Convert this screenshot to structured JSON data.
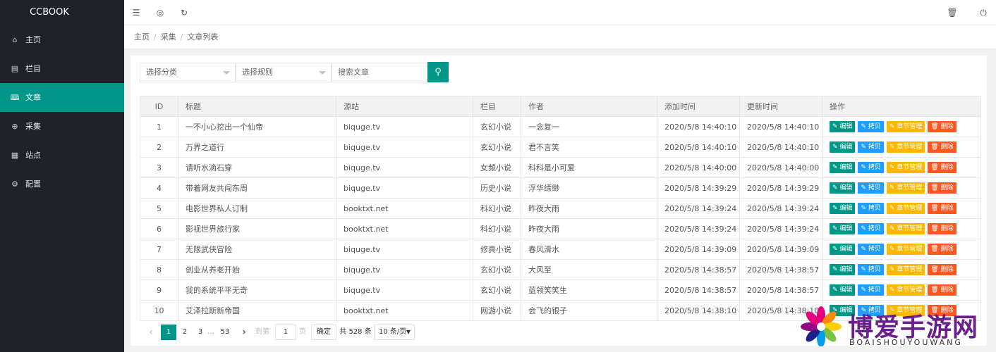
{
  "sidebar": {
    "logo": "CCBOOK",
    "items": [
      {
        "label": "主页",
        "icon": "⌂"
      },
      {
        "label": "栏目",
        "icon": "▤"
      },
      {
        "label": "文章",
        "icon": "🕮"
      },
      {
        "label": "采集",
        "icon": "⊕"
      },
      {
        "label": "站点",
        "icon": "▦"
      },
      {
        "label": "配置",
        "icon": "⚙"
      }
    ],
    "active_index": 2
  },
  "header": {
    "menu_icon": "☰",
    "globe_icon": "◎",
    "refresh_icon": "↻",
    "trash_icon": "🗑",
    "power_icon": "⏻"
  },
  "breadcrumb": [
    "主页",
    "采集",
    "文章列表"
  ],
  "filters": {
    "category_placeholder": "选择分类",
    "rule_placeholder": "选择规则",
    "search_placeholder": "搜索文章",
    "search_icon": "⚲"
  },
  "table": {
    "headers": [
      "ID",
      "标题",
      "源站",
      "栏目",
      "作者",
      "添加时间",
      "更新时间",
      "操作"
    ],
    "rows": [
      [
        "1",
        "一不小心挖出一个仙帝",
        "biquge.tv",
        "玄幻小说",
        "一念复一",
        "2020/5/8 14:40:10",
        "2020/5/8 14:40:10"
      ],
      [
        "2",
        "万界之道行",
        "biquge.tv",
        "玄幻小说",
        "君不言笑",
        "2020/5/8 14:40:10",
        "2020/5/8 14:40:10"
      ],
      [
        "3",
        "请听水滴石穿",
        "biquge.tv",
        "女频小说",
        "科科是小可爱",
        "2020/5/8 14:40:00",
        "2020/5/8 14:40:00"
      ],
      [
        "4",
        "带着网友共闯东周",
        "biquge.tv",
        "历史小说",
        "浮华缥缈",
        "2020/5/8 14:39:29",
        "2020/5/8 14:39:29"
      ],
      [
        "5",
        "电影世界私人订制",
        "booktxt.net",
        "科幻小说",
        "昨夜大雨",
        "2020/5/8 14:39:24",
        "2020/5/8 14:39:24"
      ],
      [
        "6",
        "影视世界旅行家",
        "booktxt.net",
        "科幻小说",
        "昨夜大雨",
        "2020/5/8 14:39:24",
        "2020/5/8 14:39:24"
      ],
      [
        "7",
        "无限武侠冒险",
        "biquge.tv",
        "修真小说",
        "春风滑水",
        "2020/5/8 14:39:09",
        "2020/5/8 14:39:09"
      ],
      [
        "8",
        "创业从养老开始",
        "biquge.tv",
        "玄幻小说",
        "大风至",
        "2020/5/8 14:38:57",
        "2020/5/8 14:38:57"
      ],
      [
        "9",
        "我的系统平平无奇",
        "biquge.tv",
        "玄幻小说",
        "蓝领笑笑生",
        "2020/5/8 14:38:57",
        "2020/5/8 14:38:57"
      ],
      [
        "10",
        "艾泽拉斯新帝国",
        "booktxt.net",
        "网游小说",
        "会飞的银子",
        "2020/5/8 14:38:10",
        "2020/5/8 14:38:10"
      ]
    ],
    "actions": {
      "edit": "编辑",
      "copy": "拷贝",
      "chapters": "章节管理",
      "delete": "删除"
    }
  },
  "pager": {
    "prev": "‹",
    "pages": [
      "1",
      "2",
      "3"
    ],
    "ellipsis": "…",
    "last": "53",
    "next": "›",
    "goto_label": "到第",
    "goto_value": "1",
    "page_unit": "页",
    "confirm": "确定",
    "total": "共 528 条",
    "per_page": "10 条/页"
  },
  "watermark": {
    "text": "博爱手游网",
    "sub": "BOAISHOUYOUWANG"
  },
  "colors": {
    "accent": "#009688",
    "sidebar": "#20222a",
    "edit": "#009688",
    "copy": "#1e9fff",
    "chapters": "#ffb800",
    "delete": "#ff5722"
  }
}
